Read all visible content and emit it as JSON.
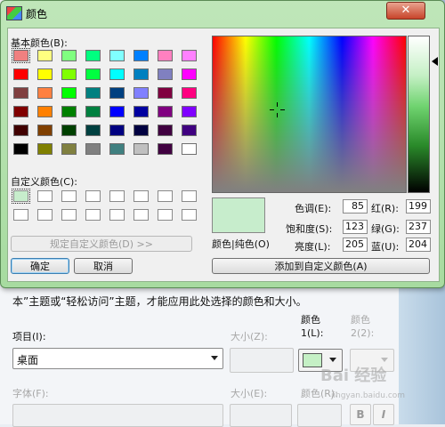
{
  "dialog": {
    "title": "颜色",
    "close_glyph": "✕",
    "basic_colors_label": "基本颜色(B):",
    "custom_colors_label": "自定义颜色(C):",
    "define_custom_button": "规定自定义颜色(D) >>",
    "ok_button": "确定",
    "cancel_button": "取消",
    "add_custom_button": "添加到自定义颜色(A)",
    "color_solid_label": "颜色|纯色(O)",
    "fields": {
      "hue_label": "色调(E):",
      "hue_value": "85",
      "sat_label": "饱和度(S):",
      "sat_value": "123",
      "lum_label": "亮度(L):",
      "lum_value": "205",
      "red_label": "红(R):",
      "red_value": "199",
      "green_label": "绿(G):",
      "green_value": "237",
      "blue_label": "蓝(U):",
      "blue_value": "204"
    },
    "basic_colors": [
      "#f08080",
      "#ffff80",
      "#80ff80",
      "#00ff80",
      "#80ffff",
      "#0080ff",
      "#ff80c0",
      "#ff80ff",
      "#ff0000",
      "#ffff00",
      "#80ff00",
      "#00ff40",
      "#00ffff",
      "#0080c0",
      "#8080c0",
      "#ff00ff",
      "#804040",
      "#ff8040",
      "#00ff00",
      "#008080",
      "#004080",
      "#8080ff",
      "#800040",
      "#ff0080",
      "#800000",
      "#ff8000",
      "#008000",
      "#008040",
      "#0000ff",
      "#0000a0",
      "#800080",
      "#8000ff",
      "#400000",
      "#804000",
      "#004000",
      "#004040",
      "#000080",
      "#000040",
      "#400040",
      "#400080",
      "#000000",
      "#808000",
      "#808040",
      "#808080",
      "#408080",
      "#c0c0c0",
      "#400040",
      "#ffffff"
    ],
    "preview_color": "#c7edcc"
  },
  "background": {
    "description": "本”主题或“轻松访问”主题，才能应用此处选择的颜色和大小。",
    "item_label": "项目(I):",
    "item_value": "桌面",
    "size_label": "大小(Z):",
    "color1_label": "颜色\n1(L):",
    "color2_label": "颜色\n2(2):",
    "font_label": "字体(F):",
    "font_size_label": "大小(E):",
    "font_color_label": "颜色(R):",
    "bold_label": "B",
    "italic_label": "I",
    "watermark": "Bai 经验",
    "watermark_url": "jingyan.baidu.com"
  }
}
